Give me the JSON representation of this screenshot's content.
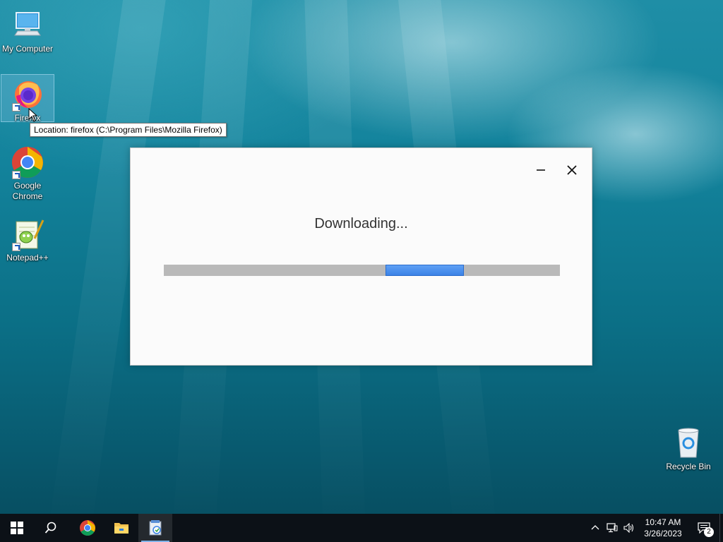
{
  "desktop": {
    "icons": [
      {
        "label": "My Computer",
        "icon": "computer-icon"
      },
      {
        "label": "Firefox",
        "icon": "firefox-icon"
      },
      {
        "label": "Google Chrome",
        "icon": "chrome-icon"
      },
      {
        "label": "Notepad++",
        "icon": "notepadpp-icon"
      },
      {
        "label": "Recycle Bin",
        "icon": "recycle-bin-icon"
      }
    ],
    "tooltip": "Location: firefox (C:\\Program Files\\Mozilla Firefox)"
  },
  "dialog": {
    "title": "Downloading...",
    "minimize_icon": "minimize-icon",
    "close_icon": "close-icon",
    "progress": {
      "start_fraction": 0.56,
      "end_fraction": 0.757,
      "indeterminate": true,
      "fill_color": "#4a90ee",
      "track_color": "#b9b9b9"
    }
  },
  "taskbar": {
    "items": [
      "start-icon",
      "search-icon",
      "chrome-icon",
      "file-explorer-icon",
      "installer-icon"
    ],
    "active_item": "installer-icon",
    "tray": {
      "icons": [
        "chevron-up-icon",
        "network-icon",
        "volume-icon"
      ],
      "time": "10:47 AM",
      "date": "3/26/2023",
      "notification_count": "2"
    }
  },
  "colors": {
    "taskbar": "#0c1117",
    "accent": "#3b82e6"
  }
}
